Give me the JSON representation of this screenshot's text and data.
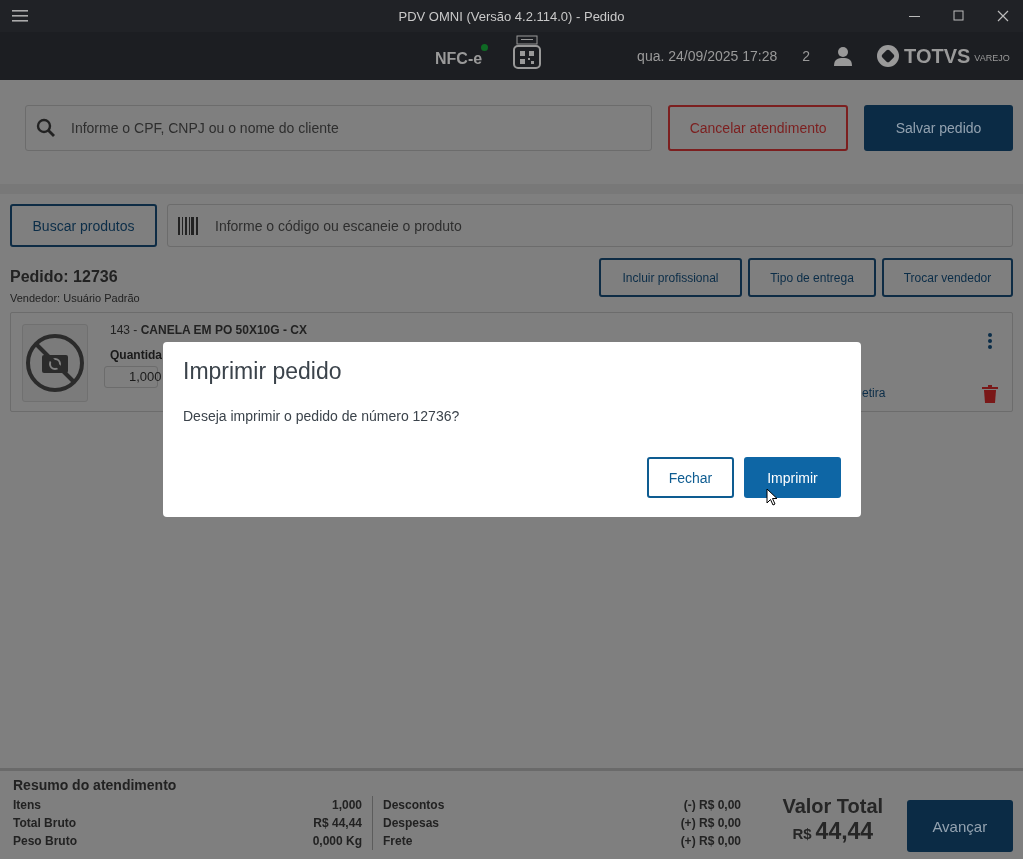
{
  "window": {
    "title": "PDV OMNI (Versão 4.2.114.0) - Pedido"
  },
  "header": {
    "fiscal_label": "NFC-e",
    "fiscal_online": true,
    "datetime": "qua. 24/09/2025 17:28",
    "user_count": "2",
    "brand": "TOTVS",
    "brand_sub": "VAREJO"
  },
  "customer_search": {
    "placeholder": "Informe o CPF, CNPJ ou o nome do cliente"
  },
  "actions": [
    {
      "label": "Cancelar atendimento",
      "kind": "danger"
    },
    {
      "label": "Salvar pedido",
      "kind": "primary"
    }
  ],
  "product_search": {
    "button": "Buscar produtos",
    "placeholder": "Informe o código ou escaneie o produto"
  },
  "order": {
    "title": "Pedido: 12736",
    "seller": "Vendedor: Usuário Padrão",
    "buttons": [
      "Incluir profissional",
      "Tipo de entrega",
      "Trocar vendedor"
    ]
  },
  "items": [
    {
      "line": "143 - **CANELA EM PO 50X10G - CX**",
      "quantity_label": "Quantida",
      "quantity": "1,000",
      "delivery": "etira"
    }
  ],
  "dialog": {
    "title": "Imprimir pedido",
    "message": "Deseja imprimir o pedido de número 12736?",
    "buttons": [
      {
        "label": "Fechar",
        "kind": "secondary"
      },
      {
        "label": "Imprimir",
        "kind": "primary"
      }
    ]
  },
  "summary": {
    "title": "Resumo do atendimento",
    "left": [
      {
        "label": "Itens",
        "value": "1,000"
      },
      {
        "label": "Total Bruto",
        "value": "R$ 44,44"
      },
      {
        "label": "Peso Bruto",
        "value": "0,000 Kg"
      }
    ],
    "right": [
      {
        "label": "Descontos",
        "value": "(-) R$ 0,00"
      },
      {
        "label": "Despesas",
        "value": "(+) R$ 0,00"
      },
      {
        "label": "Frete",
        "value": "(+) R$ 0,00"
      }
    ],
    "total_label": "Valor Total",
    "total_currency": "R$",
    "total_value": "44,44",
    "button": "Avançar"
  }
}
